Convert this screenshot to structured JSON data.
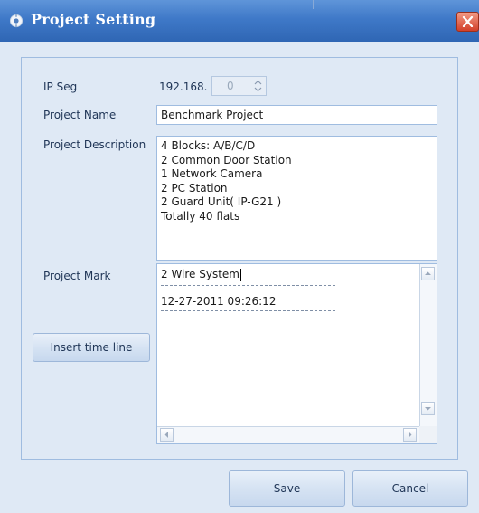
{
  "window": {
    "title": "Project Setting",
    "close_icon": "close-icon",
    "title_icon": "settings-icon"
  },
  "form": {
    "ip_seg_label": "IP Seg",
    "ip_prefix": "192.168.",
    "ip_value": "0",
    "project_name_label": "Project Name",
    "project_name_value": "Benchmark Project",
    "project_description_label": "Project Description",
    "project_description_lines": [
      "4 Blocks: A/B/C/D",
      "2 Common Door Station",
      "1 Network Camera",
      "2 PC Station",
      "2 Guard Unit( IP-G21 )",
      "Totally 40 flats"
    ],
    "project_mark_label": "Project Mark",
    "project_mark_line1": "2 Wire System",
    "project_mark_line2": "12-27-2011 09:26:12",
    "insert_time_line_label": "Insert time line"
  },
  "footer": {
    "save_label": "Save",
    "cancel_label": "Cancel"
  },
  "colors": {
    "titlebar": "#3f79c8",
    "background": "#dfe9f5",
    "close_button": "#d2402a"
  }
}
